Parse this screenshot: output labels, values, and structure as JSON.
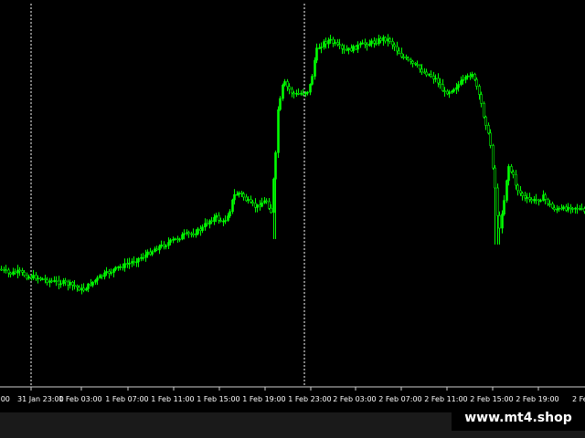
{
  "chart_data": {
    "type": "candlestick",
    "x_ticks": [
      "1 Feb 03:00",
      "1 Feb 07:00",
      "1 Feb 11:00",
      "1 Feb 15:00",
      "1 Feb 19:00",
      "1 Feb 23:00",
      "2 Feb 03:00",
      "2 Feb 07:00",
      "2 Feb 11:00",
      "2 Feb 15:00",
      "2 Feb 19:00"
    ],
    "x_ticks_partial": [
      "31 Jan 23:00"
    ],
    "period_separators": [
      "31 Jan 23:00",
      "1 Feb 23:00"
    ],
    "grid": false,
    "colors": {
      "background": "#000000",
      "candle": "#00ff00",
      "separator": "#ffffff",
      "axis_text": "#ffffff"
    }
  },
  "watermark": "www.mt4.shop"
}
